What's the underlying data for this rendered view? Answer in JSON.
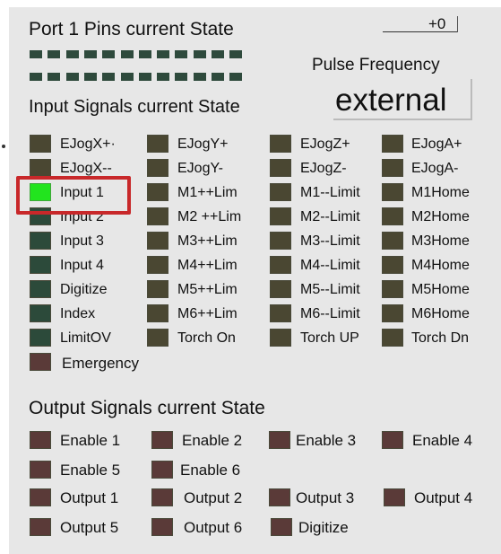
{
  "header": {
    "port_state_title": "Port 1 Pins current State",
    "counter_value": "+0",
    "pulse_frequency_label": "Pulse Frequency",
    "input_title": "Input Signals current State",
    "frequency_mode": "external",
    "output_title": "Output Signals current State"
  },
  "port_pins": {
    "row_count": 2,
    "pins_per_row": 12,
    "led_color": "#2e4a3c"
  },
  "inputs": {
    "col1": [
      "EJogX+·",
      "EJogX--",
      "Input 1",
      "Input 2",
      "Input 3",
      "Input 4",
      "Digitize",
      "Index",
      "LimitOV"
    ],
    "col2": [
      "EJogY+",
      "EJogY-",
      "M1++Lim",
      "M2 ++Lim",
      "M3++Lim",
      "M4++Lim",
      "M5++Lim",
      "M6++Lim",
      "Torch On"
    ],
    "col3": [
      "EJogZ+",
      "EJogZ-",
      "M1--Limit",
      "M2--Limit",
      "M3--Limit",
      "M4--Limit",
      "M5--Limit",
      "M6--Limit",
      "Torch UP"
    ],
    "col4": [
      "EJogA+",
      "EJogA-",
      "M1Home",
      "M2Home",
      "M3Home",
      "M4Home",
      "M5Home",
      "M6Home",
      "Torch Dn"
    ],
    "emergency": "Emergency",
    "active_input": "Input 1"
  },
  "outputs": {
    "row1": [
      "Enable 1",
      "Enable 2",
      "Enable 3",
      "Enable 4"
    ],
    "row2": [
      "Enable 5",
      "Enable 6"
    ],
    "row3": [
      "Output 1",
      "Output 2",
      "Output 3",
      "Output 4"
    ],
    "row4": [
      "Output 5",
      "Output 6",
      "Digitize"
    ]
  },
  "colors": {
    "panel_bg": "#e7e7e7",
    "led_off_olive": "#4a4732",
    "led_off_green": "#2c4a3a",
    "led_off_maroon": "#5a3a38",
    "led_on": "#22e41e",
    "highlight": "#c8282a"
  }
}
